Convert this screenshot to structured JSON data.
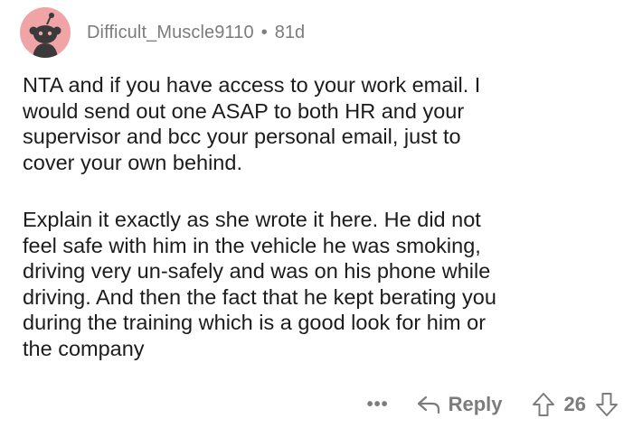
{
  "comment": {
    "author": "Difficult_Muscle9110",
    "separator": "•",
    "age": "81d",
    "paragraphs": [
      "NTA and if you have access to your work email. I\nwould send out one ASAP to both HR and your\nsupervisor and bcc your personal email, just to\ncover your own behind.",
      "Explain it exactly as she wrote it here. He did not\nfeel safe with him in the vehicle he was smoking,\ndriving very un-safely and was on his phone while\ndriving. And then the fact that he kept berating you\nduring the training which is a good look for him or\nthe company"
    ]
  },
  "actions": {
    "more_label": "•••",
    "reply_label": "Reply",
    "score": "26"
  },
  "colors": {
    "avatar_bg": "#f0a4a6",
    "meta_text": "#7c7c7c",
    "body_text": "#1c1c1c"
  },
  "icons": {
    "avatar": "reddit-snoo-icon",
    "reply": "reply-arrow-icon",
    "upvote": "upvote-arrow-icon",
    "downvote": "downvote-arrow-icon"
  }
}
